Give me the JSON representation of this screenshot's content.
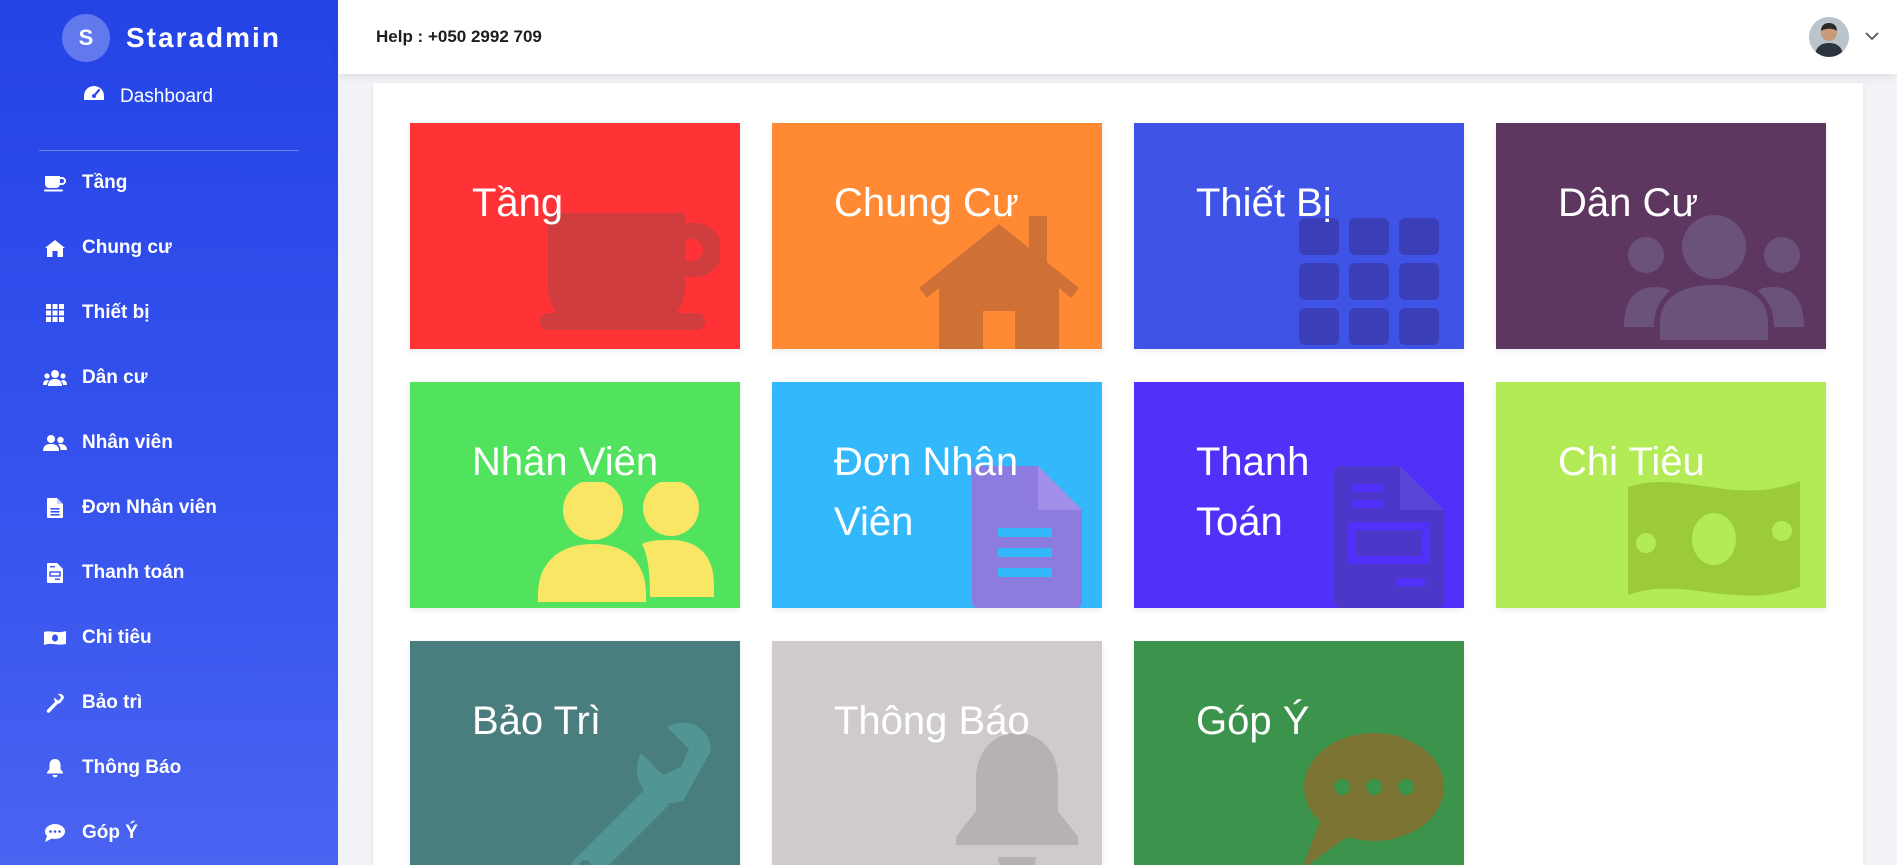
{
  "sidebar": {
    "brand_letter": "S",
    "brand_name": "Staradmin",
    "dashboard_label": "Dashboard",
    "items": [
      {
        "label": "Tầng",
        "icon": "coffee-cup-icon"
      },
      {
        "label": "Chung cư",
        "icon": "home-icon"
      },
      {
        "label": "Thiết bị",
        "icon": "grid-icon"
      },
      {
        "label": "Dân cư",
        "icon": "users-group-icon"
      },
      {
        "label": "Nhân viên",
        "icon": "user-friends-icon"
      },
      {
        "label": "Đơn Nhân viên",
        "icon": "file-icon"
      },
      {
        "label": "Thanh toán",
        "icon": "invoice-icon"
      },
      {
        "label": "Chi tiêu",
        "icon": "money-bill-icon"
      },
      {
        "label": "Bảo trì",
        "icon": "wrench-icon"
      },
      {
        "label": "Thông Báo",
        "icon": "bell-icon"
      },
      {
        "label": "Góp Ý",
        "icon": "comment-icon"
      }
    ]
  },
  "header": {
    "help_text": "Help : +050 2992 709",
    "avatar_icon": "user-avatar-icon",
    "menu_icon": "chevron-down-icon"
  },
  "tiles": [
    {
      "title": "Tầng",
      "color": "#ff3236",
      "icon": "coffee-cup-icon"
    },
    {
      "title": "Chung Cư",
      "color": "#ff8a33",
      "icon": "home-icon"
    },
    {
      "title": "Thiết Bị",
      "color": "#3f54e6",
      "icon": "grid-icon"
    },
    {
      "title": "Dân Cư",
      "color": "#5e3761",
      "icon": "users-group-icon"
    },
    {
      "title": "Nhân Viên",
      "color": "#52e35e",
      "icon": "user-friends-icon"
    },
    {
      "title": "Đơn Nhân Viên",
      "color": "#33b9fb",
      "icon": "file-icon"
    },
    {
      "title": "Thanh Toán",
      "color": "#5131f9",
      "icon": "invoice-icon"
    },
    {
      "title": "Chi Tiêu",
      "color": "#b2eb56",
      "icon": "money-bill-icon"
    },
    {
      "title": "Bảo Trì",
      "color": "#4a7d7d",
      "icon": "wrench-icon"
    },
    {
      "title": "Thông Báo",
      "color": "#cfcbcb",
      "icon": "bell-icon"
    },
    {
      "title": "Góp Ý",
      "color": "#3b934c",
      "icon": "comment-icon"
    }
  ]
}
